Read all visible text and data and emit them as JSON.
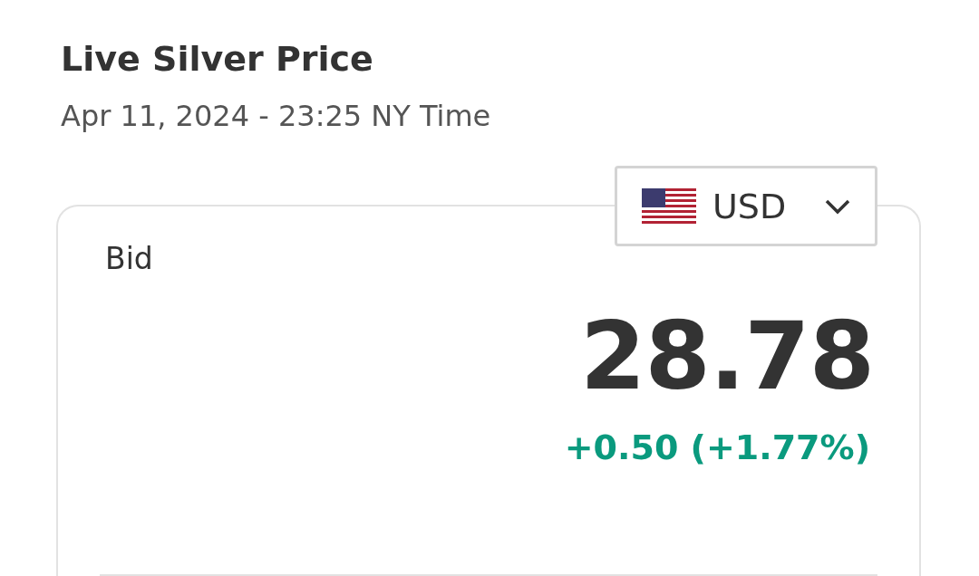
{
  "title": "Live Silver Price",
  "timestamp": "Apr 11, 2024 - 23:25 NY Time",
  "currency": {
    "code": "USD"
  },
  "quote": {
    "label": "Bid",
    "price": "28.78",
    "change": "+0.50 (+1.77%)",
    "positive": true
  }
}
